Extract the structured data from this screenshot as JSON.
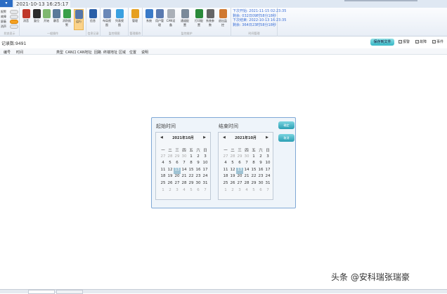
{
  "titlebar": {
    "menu": "▾",
    "clock": "2021-10-13 16:25:17"
  },
  "status_toggles": [
    {
      "label": "报警",
      "on": false
    },
    {
      "label": "故障",
      "on": false
    },
    {
      "label": "屏蔽",
      "on": true
    },
    {
      "label": "消声",
      "on": false
    }
  ],
  "ribbon": {
    "buttons": [
      {
        "label": "消音",
        "color": "#c0392b"
      },
      {
        "label": "复位",
        "color": "#2d2d2d"
      },
      {
        "label": "开始",
        "color": "#7fb870"
      },
      {
        "label": "静音",
        "color": "#5a7a9a"
      },
      {
        "label": "消防报警",
        "color": "#3aa04a"
      },
      {
        "label": "运行",
        "color": "#5577aa",
        "selected": true
      },
      {
        "label": "信息",
        "color": "#2a5fa8"
      },
      {
        "label": "布局视图",
        "color": "#6a88b8"
      },
      {
        "label": "列表视图",
        "color": "#3aa0e0"
      },
      {
        "label": "管理",
        "color": "#e6a020"
      },
      {
        "label": "系统",
        "color": "#3a7ac8"
      },
      {
        "label": "用户管理",
        "color": "#5a7ab0"
      },
      {
        "label": "CAN设备",
        "color": "#aab0b8"
      },
      {
        "label": "通道配置",
        "color": "#7a8a9a"
      },
      {
        "label": "打印配置",
        "color": "#2a8a3a"
      },
      {
        "label": "系统参数",
        "color": "#666"
      },
      {
        "label": "退出监控",
        "color": "#d07830"
      }
    ],
    "groups": [
      "状态显示",
      "一般操作",
      "信息记录",
      "监控视图",
      "管理操作",
      "监控维护",
      "时间管理"
    ]
  },
  "time_info": [
    "下次开始: 2021-11-15 02:23:35",
    "剩余: 032日09时58分18秒",
    "下次结束: 2022-10-13 16:23:35",
    "剩余: 364日23时58分18秒"
  ],
  "records": "记录数:9491",
  "save_button": "保存到文件",
  "filters": [
    {
      "label": "报警",
      "checked": true
    },
    {
      "label": "故障",
      "checked": true
    },
    {
      "label": "事件",
      "checked": true
    }
  ],
  "columns": [
    "编号",
    "时间",
    "类型",
    "CAN口",
    "CAN地址",
    "回路",
    "终端地址",
    "区域",
    "位置",
    "说明"
  ],
  "dialog": {
    "start_label": "起始时间",
    "end_label": "结束时间",
    "month": "2021年10月",
    "weekdays": [
      "一",
      "二",
      "三",
      "四",
      "五",
      "六",
      "日"
    ],
    "days": [
      "27",
      "28",
      "29",
      "30",
      "1",
      "2",
      "3",
      "4",
      "5",
      "6",
      "7",
      "8",
      "9",
      "10",
      "11",
      "12",
      "13",
      "14",
      "15",
      "16",
      "17",
      "18",
      "19",
      "20",
      "21",
      "22",
      "23",
      "24",
      "25",
      "26",
      "27",
      "28",
      "29",
      "30",
      "31",
      "1",
      "2",
      "3",
      "4",
      "5",
      "6",
      "7"
    ],
    "selected_day": "13",
    "ok": "确定",
    "cancel": "取消"
  },
  "watermark": "头条 @安科瑞张瑞豪"
}
